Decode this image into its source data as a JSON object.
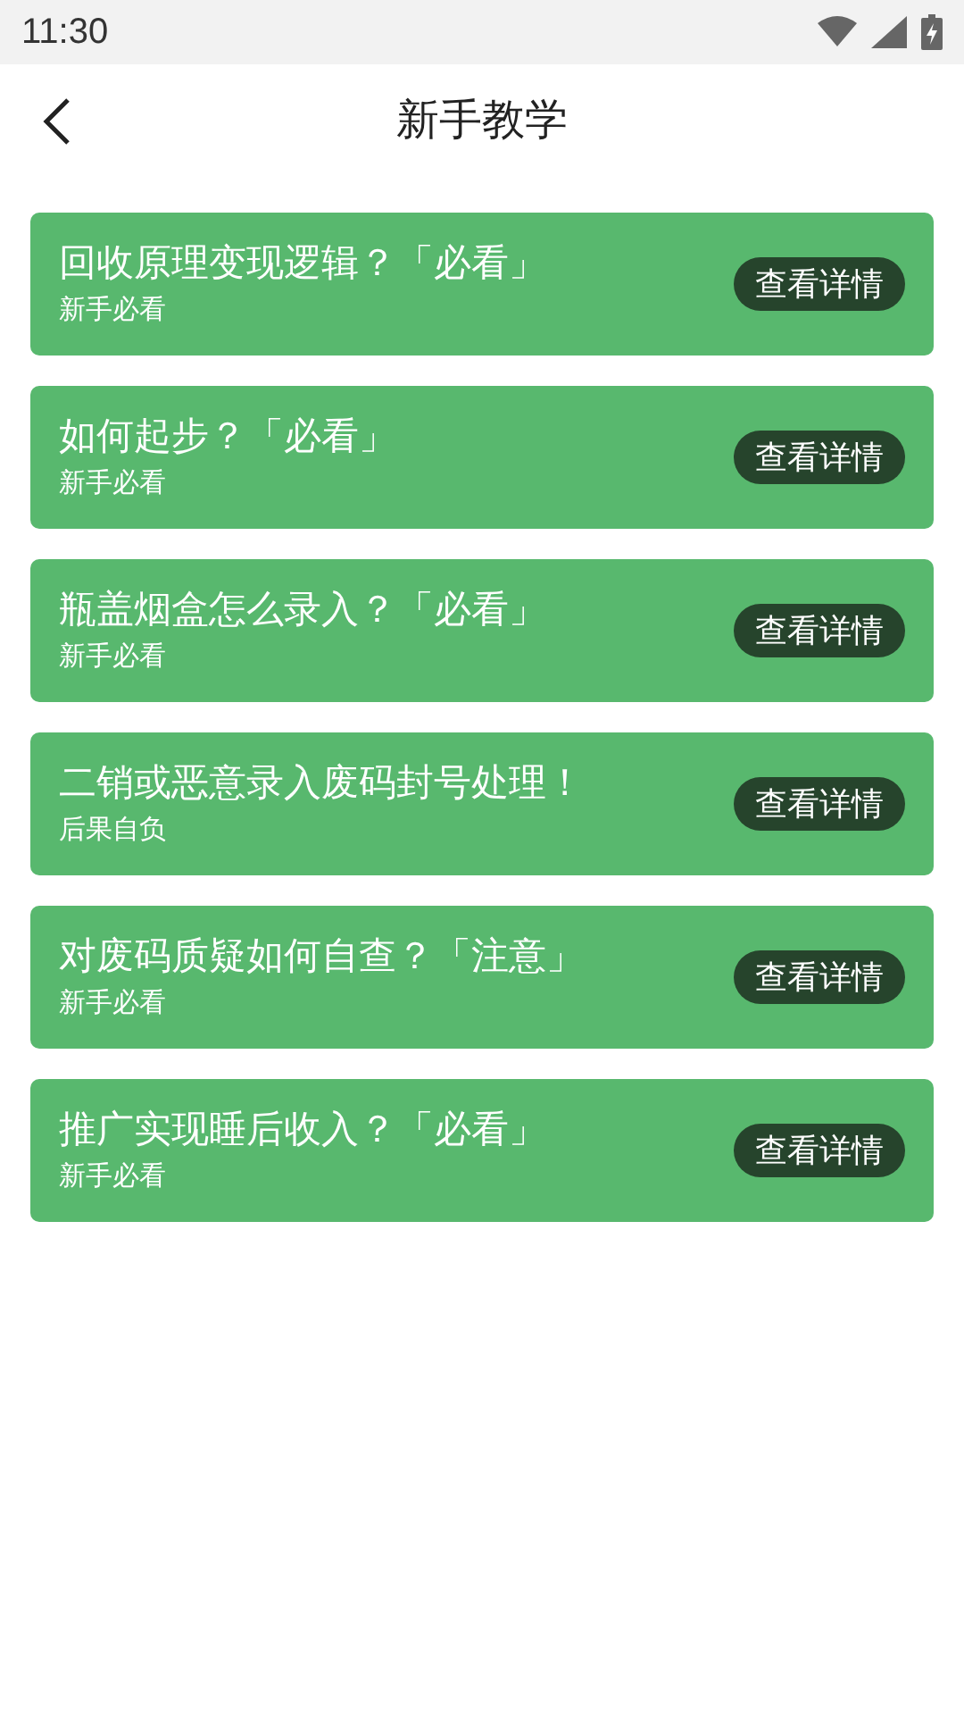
{
  "status_bar": {
    "time": "11:30"
  },
  "header": {
    "title": "新手教学"
  },
  "cards": [
    {
      "title": "回收原理变现逻辑？「必看」",
      "subtitle": "新手必看",
      "button": "查看详情"
    },
    {
      "title": "如何起步？「必看」",
      "subtitle": "新手必看",
      "button": "查看详情"
    },
    {
      "title": "瓶盖烟盒怎么录入？「必看」",
      "subtitle": "新手必看",
      "button": "查看详情"
    },
    {
      "title": "二销或恶意录入废码封号处理！",
      "subtitle": "后果自负",
      "button": "查看详情"
    },
    {
      "title": "对废码质疑如何自查？「注意」",
      "subtitle": "新手必看",
      "button": "查看详情"
    },
    {
      "title": "推广实现睡后收入？「必看」",
      "subtitle": "新手必看",
      "button": "查看详情"
    }
  ]
}
